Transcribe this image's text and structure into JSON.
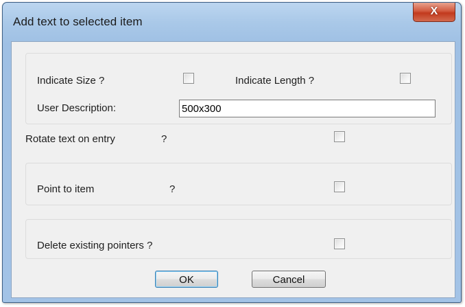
{
  "window": {
    "title": "Add text to selected item",
    "close_label": "X"
  },
  "size_group": {
    "indicate_size_label": "Indicate Size ?",
    "indicate_size_checked": false,
    "indicate_length_label": "Indicate Length ?",
    "indicate_length_checked": false,
    "user_description_label": "User Description:",
    "user_description_value": "500x300"
  },
  "rotate": {
    "label": "Rotate text on entry",
    "question": "?",
    "checked": false
  },
  "point_group": {
    "label": "Point to item",
    "question": "?",
    "checked": false
  },
  "delete_group": {
    "label": "Delete existing pointers ?",
    "checked": false
  },
  "buttons": {
    "ok_label": "OK",
    "cancel_label": "Cancel"
  }
}
